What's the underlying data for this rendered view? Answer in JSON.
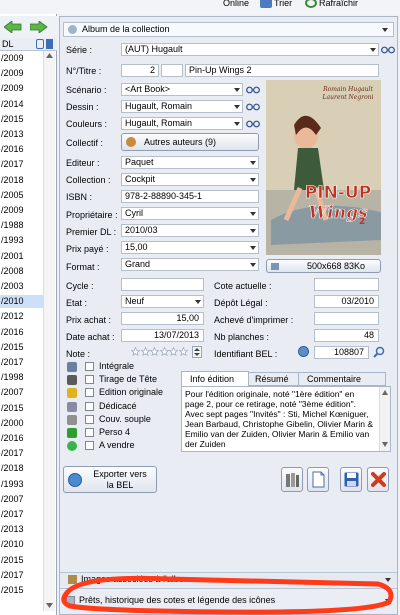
{
  "topbar": {
    "online": "Online",
    "trier": "Trier",
    "rafraichir": "Rafraîchir"
  },
  "left_panel": {
    "header": "DL",
    "rows": [
      "/2009",
      "/2009",
      "/2009",
      "/2014",
      "/2015",
      "/2013",
      "/2016",
      "/2017",
      "/2018",
      "/2005",
      "/2009",
      "/1988",
      "/1993",
      "/2001",
      "/2008",
      "/2003",
      "/2010",
      "/2012",
      "/2016",
      "/2015",
      "/2017",
      "/1998",
      "/2007",
      "/2015",
      "/2000",
      "/2016",
      "/2017",
      "/2018",
      "/1993",
      "/2007",
      "/2017",
      "/2013",
      "/2010",
      "/2015",
      "/2017",
      "/2015"
    ],
    "selected_index": 16
  },
  "album_selector": {
    "value": "Album de la collection"
  },
  "form": {
    "serie": {
      "label": "Série :",
      "value": "(AUT) Hugault"
    },
    "numero": {
      "label": "N°/Titre :",
      "number": "2",
      "title": "Pin-Up Wings 2"
    },
    "scenario": {
      "label": "Scénario :",
      "value": "<Art Book>"
    },
    "dessin": {
      "label": "Dessin :",
      "value": "Hugault, Romain"
    },
    "couleurs": {
      "label": "Couleurs :",
      "value": "Hugault, Romain"
    },
    "collectif": {
      "label": "Collectif :",
      "button": "Autres auteurs (9)"
    },
    "editeur": {
      "label": "Editeur :",
      "value": "Paquet"
    },
    "collection": {
      "label": "Collection :",
      "value": "Cockpit"
    },
    "isbn": {
      "label": "ISBN :",
      "value": "978-2-88890-345-1"
    },
    "proprietaire": {
      "label": "Propriétaire :",
      "value": "Cyril"
    },
    "premier_dl": {
      "label": "Premier DL :",
      "value": "2010/03"
    },
    "prix_paye": {
      "label": "Prix payé :",
      "value": "15,00"
    },
    "format": {
      "label": "Format :",
      "value": "Grand"
    },
    "cycle": {
      "label": "Cycle :",
      "value": ""
    },
    "cote_actuelle": {
      "label": "Cote actuelle :",
      "value": ""
    },
    "etat": {
      "label": "Etat :",
      "value": "Neuf"
    },
    "depot_legal": {
      "label": "Dépôt Légal :",
      "value": "03/2010"
    },
    "prix_achat": {
      "label": "Prix achat :",
      "value": "15,00"
    },
    "acheve_imprimer": {
      "label": "Achevé d'imprimer :",
      "value": ""
    },
    "date_achat": {
      "label": "Date achat :",
      "value": "13/07/2013"
    },
    "nb_planches": {
      "label": "Nb planches :",
      "value": "48"
    },
    "note": {
      "label": "Note :",
      "stars": 0,
      "max": 6
    },
    "identifiant_bel": {
      "label": "Identifiant BEL :",
      "value": "108807"
    }
  },
  "cover": {
    "size_label": "500x668 83Ko",
    "authors_line1": "Romain Hugault",
    "authors_line2": "Laurent Negroni",
    "title_line1": "PIN-UP",
    "title_line2": "Wings",
    "title_number": "2",
    "colors": {
      "sky": "#d9cfb6",
      "plane": "#8a9aa3",
      "title": "#c0321e"
    }
  },
  "checkboxes": [
    {
      "label": "Intégrale",
      "icon": "integrale-icon"
    },
    {
      "label": "Tirage de Tête",
      "icon": "tirage-icon"
    },
    {
      "label": "Edition originale",
      "icon": "star-icon"
    },
    {
      "label": "Dédicacé",
      "icon": "pen-icon"
    },
    {
      "label": "Couv. souple",
      "icon": "paperclip-icon"
    },
    {
      "label": "Perso 4",
      "icon": "checkmark-icon"
    },
    {
      "label": "A vendre",
      "icon": "green-dot-icon"
    }
  ],
  "tabs": {
    "items": [
      "Info édition",
      "Résumé",
      "Commentaire"
    ],
    "active": 0
  },
  "info_edition_text": "Pour l'édition originale, noté \"1ère édition\" en page 2, pour ce retirage, noté \"3ème édition\".\nAvec sept pages \"Invités\" : Sti, Michel Kœniguer, Jean Barbaud, Christophe Gibelin, Olivier Marin & Emilio van der Zuiden, Olivier Marin & Emilio van der Zuiden",
  "export_button": {
    "line1": "Exporter vers",
    "line2": "la BEL"
  },
  "bottom": {
    "images_label": "Images associées à l'album",
    "prets_label": "Prêts, historique des cotes et légende des icônes"
  }
}
